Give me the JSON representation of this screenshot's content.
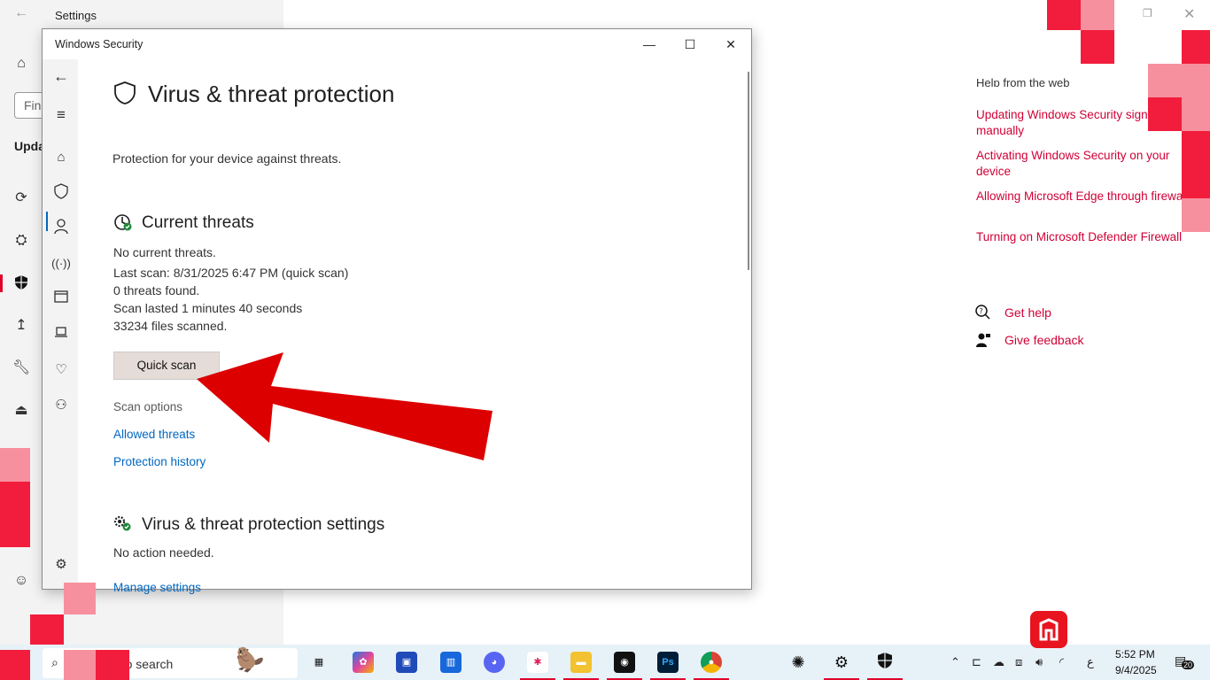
{
  "settings": {
    "title": "Settings",
    "search_placeholder": "Fin",
    "section_label": "Upda"
  },
  "help": {
    "heading": "Help from the web",
    "links": [
      "Updating Windows Security signatures manually",
      "Activating Windows Security on your device",
      "Allowing Microsoft Edge through firewall",
      "Turning on Microsoft Defender Firewall"
    ],
    "get_help": "Get help",
    "give_feedback": "Give feedback"
  },
  "security": {
    "window_title": "Windows Security",
    "page_title": "Virus & threat protection",
    "page_subtitle": "Protection for your device against threats.",
    "current_threats": {
      "heading": "Current threats",
      "status": "No current threats.",
      "last_scan": "Last scan: 8/31/2025 6:47 PM (quick scan)",
      "threats_found": "0 threats found.",
      "scan_duration": "Scan lasted 1 minutes 40 seconds",
      "files_scanned": "33234 files scanned.",
      "quick_scan_button": "Quick scan",
      "scan_options": "Scan options",
      "allowed_threats": "Allowed threats",
      "protection_history": "Protection history"
    },
    "settings_section": {
      "heading": "Virus & threat protection settings",
      "status": "No action needed.",
      "manage_link": "Manage settings"
    }
  },
  "taskbar": {
    "search_text": "e to search",
    "clock_time": "5:52 PM",
    "clock_date": "9/4/2025",
    "notification_count": "20",
    "keyboard_lang": "ع"
  },
  "colors": {
    "accent_red": "#e0002a",
    "link_blue": "#0067c0",
    "help_link": "#d10035"
  }
}
